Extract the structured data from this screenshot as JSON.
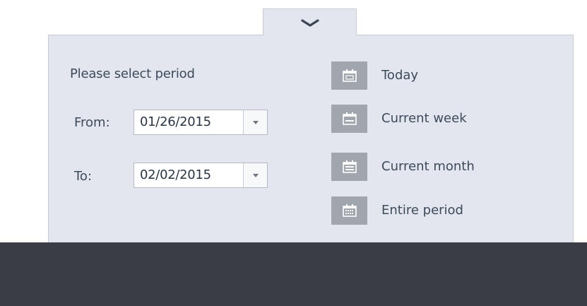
{
  "panel": {
    "prompt": "Please select period",
    "collapse_icon": "chevron-down-icon"
  },
  "range": {
    "from_label": "From:",
    "from_value": "01/26/2015",
    "to_label": "To:",
    "to_value": "02/02/2015",
    "dropdown_icon": "dropdown-arrow-icon"
  },
  "presets": [
    {
      "label": "Today",
      "icon": "calendar-day-icon"
    },
    {
      "label": "Current week",
      "icon": "calendar-week-icon"
    },
    {
      "label": "Current month",
      "icon": "calendar-month-icon"
    },
    {
      "label": "Entire period",
      "icon": "calendar-all-icon"
    }
  ],
  "colors": {
    "panel_bg": "#e3e6ef",
    "panel_border": "#c9ccd4",
    "icon_bg": "#a1a5ad",
    "text": "#3c4a5a",
    "footer_bg": "#3a3d43"
  }
}
